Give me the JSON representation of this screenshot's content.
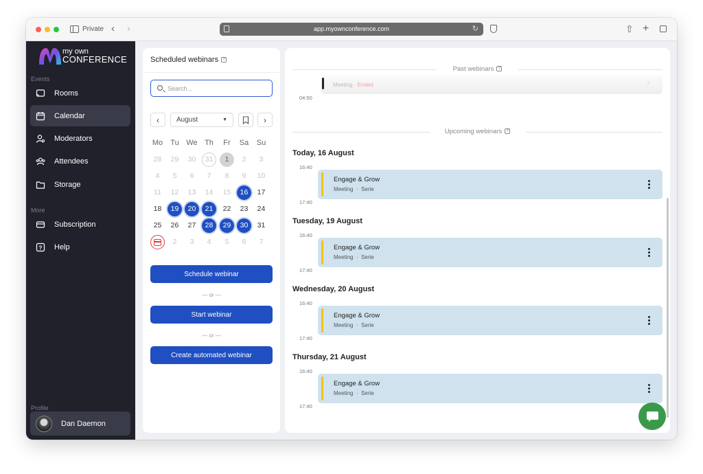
{
  "browser": {
    "private_label": "Private",
    "url": "app.myownconference.com"
  },
  "logo": {
    "line1": "my own",
    "line2": "CONFERENCE"
  },
  "sidebar": {
    "section_events": "Events",
    "section_more": "More",
    "section_profile": "Profile",
    "items": [
      {
        "label": "Rooms",
        "icon": "cast-icon"
      },
      {
        "label": "Calendar",
        "icon": "calendar-icon"
      },
      {
        "label": "Moderators",
        "icon": "user-icon"
      },
      {
        "label": "Attendees",
        "icon": "users-icon"
      },
      {
        "label": "Storage",
        "icon": "folder-icon"
      },
      {
        "label": "Subscription",
        "icon": "card-icon"
      },
      {
        "label": "Help",
        "icon": "help-icon"
      }
    ],
    "active_item": "Calendar",
    "profile_name": "Dan Daemon"
  },
  "scheduled": {
    "title": "Scheduled webinars",
    "search_placeholder": "Search...",
    "month": "August",
    "weekdays": [
      "Mo",
      "Tu",
      "We",
      "Th",
      "Fr",
      "Sa",
      "Su"
    ],
    "weeks": [
      [
        "28",
        "29",
        "30",
        "31",
        "1",
        "2",
        "3"
      ],
      [
        "4",
        "5",
        "6",
        "7",
        "8",
        "9",
        "10"
      ],
      [
        "11",
        "12",
        "13",
        "14",
        "15",
        "16",
        "17"
      ],
      [
        "18",
        "19",
        "20",
        "21",
        "22",
        "23",
        "24"
      ],
      [
        "25",
        "26",
        "27",
        "28",
        "29",
        "30",
        "31"
      ],
      [
        "",
        "2",
        "3",
        "4",
        "5",
        "6",
        "7"
      ]
    ],
    "schedule_button": "Schedule webinar",
    "or_label": "— or —",
    "start_button": "Start webinar",
    "automated_button": "Create automated webinar"
  },
  "right": {
    "past_label": "Past webinars",
    "upcoming_label": "Upcoming webinars",
    "past_item": {
      "type": "Meeting",
      "status": "Ended",
      "time": "04:50"
    },
    "days": [
      {
        "heading": "Today, 16 August",
        "start": "16:40",
        "end": "17:40",
        "title": "Engage & Grow",
        "type": "Meeting",
        "series": "Serie"
      },
      {
        "heading": "Tuesday, 19 August",
        "start": "16:40",
        "end": "17:40",
        "title": "Engage & Grow",
        "type": "Meeting",
        "series": "Serie"
      },
      {
        "heading": "Wednesday, 20 August",
        "start": "16:40",
        "end": "17:40",
        "title": "Engage & Grow",
        "type": "Meeting",
        "series": "Serie"
      },
      {
        "heading": "Thursday, 21 August",
        "start": "16:40",
        "end": "17:40",
        "title": "Engage & Grow",
        "type": "Meeting",
        "series": "Serie"
      }
    ]
  },
  "colors": {
    "accent": "#1f4fc1",
    "sidebar_bg": "#20212b",
    "event_card": "#cfe2ee",
    "event_bar": "#f1c40f",
    "chat_fab": "#3b9a49"
  }
}
